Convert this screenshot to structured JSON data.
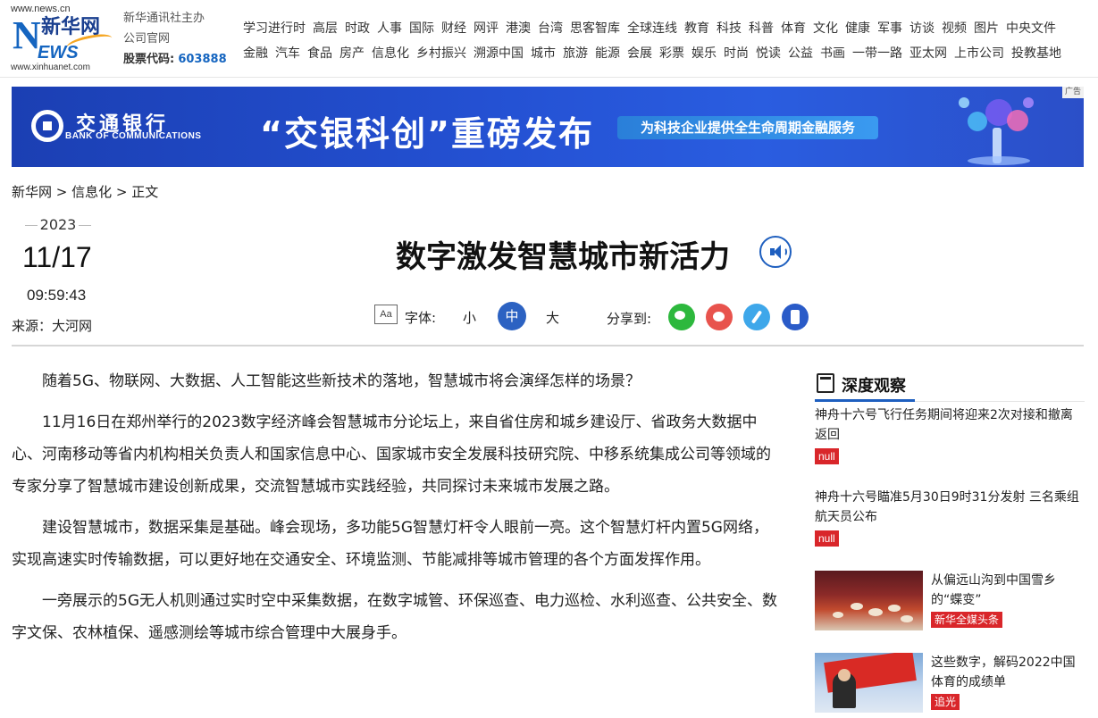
{
  "header": {
    "logo_url_top": "www.news.cn",
    "logo_n": "N",
    "logo_name": "新华网",
    "logo_ews": "EWS",
    "logo_url_bottom": "www.xinhuanet.com",
    "org_line1": "新华通讯社主办",
    "org_line2": "公司官网",
    "stock_label": "股票代码:",
    "stock_code": "603888",
    "nav_row1": [
      "学习进行时",
      "高层",
      "时政",
      "人事",
      "国际",
      "财经",
      "网评",
      "港澳",
      "台湾",
      "思客智库",
      "全球连线",
      "教育",
      "科技",
      "科普",
      "体育",
      "文化",
      "健康",
      "军事",
      "访谈",
      "视频",
      "图片",
      "中央文件"
    ],
    "nav_row2": [
      "金融",
      "汽车",
      "食品",
      "房产",
      "信息化",
      "乡村振兴",
      "溯源中国",
      "城市",
      "旅游",
      "能源",
      "会展",
      "彩票",
      "娱乐",
      "时尚",
      "悦读",
      "公益",
      "书画",
      "一带一路",
      "亚太网",
      "上市公司",
      "投教基地"
    ]
  },
  "banner": {
    "bank_cn": "交通银行",
    "bank_en": "BANK OF COMMUNICATIONS",
    "slogan": "“交银科创”重磅发布",
    "pill": "为科技企业提供全生命周期金融服务",
    "ad_tag": "广告"
  },
  "breadcrumb": {
    "home": "新华网",
    "sep1": " > ",
    "section": "信息化",
    "sep2": " > ",
    "current": "正文"
  },
  "meta": {
    "year": "2023",
    "date": "11/17",
    "time": "09:59:43",
    "source": "来源：大河网"
  },
  "article": {
    "title": "数字激发智慧城市新活力",
    "font_icon": "Aa",
    "font_label": "字体:",
    "font_small": "小",
    "font_mid": "中",
    "font_big": "大",
    "share_label": "分享到:",
    "paragraphs": [
      "随着5G、物联网、大数据、人工智能这些新技术的落地，智慧城市将会演绎怎样的场景？",
      "11月16日在郑州举行的2023数字经济峰会智慧城市分论坛上，来自省住房和城乡建设厅、省政务大数据中心、河南移动等省内机构相关负责人和国家信息中心、国家城市安全发展科技研究院、中移系统集成公司等领域的专家分享了智慧城市建设创新成果，交流智慧城市实践经验，共同探讨未来城市发展之路。",
      "建设智慧城市，数据采集是基础。峰会现场，多功能5G智慧灯杆令人眼前一亮。这个智慧灯杆内置5G网络，实现高速实时传输数据，可以更好地在交通安全、环境监测、节能减排等城市管理的各个方面发挥作用。",
      "一旁展示的5G无人机则通过实时空中采集数据，在数字城管、环保巡查、电力巡检、水利巡查、公共安全、数字文保、农林植保、遥感测绘等城市综合管理中大展身手。"
    ]
  },
  "sidebar": {
    "heading": "深度观察",
    "items": [
      {
        "title": "神舟十六号飞行任务期间将迎来2次对接和撤离返回",
        "tag": "null"
      },
      {
        "title": "神舟十六号瞄准5月30日9时31分发射 三名乘组航天员公布",
        "tag": "null"
      },
      {
        "title": "从偏远山沟到中国雪乡的“蝶变”",
        "tag": "新华全媒头条"
      },
      {
        "title": "这些数字，解码2022中国体育的成绩单",
        "tag": "追光"
      }
    ]
  },
  "colors": {
    "brand_blue": "#1e5fbf",
    "tag_red": "#d9262a",
    "banner_blue": "#2451d3"
  }
}
